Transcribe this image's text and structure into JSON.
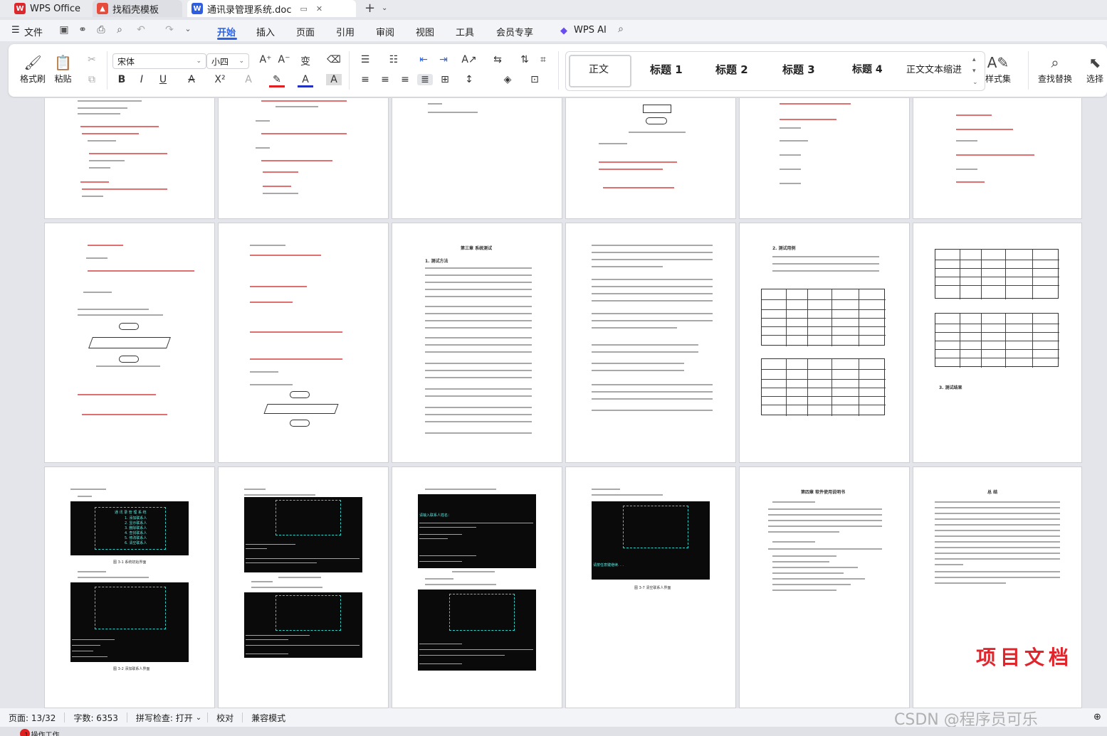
{
  "tabs": [
    {
      "label": "WPS Office",
      "logo": "W"
    },
    {
      "label": "找稻壳模板",
      "logo": "▲"
    },
    {
      "label": "通讯录管理系统.doc",
      "logo": "W"
    }
  ],
  "menu": {
    "file": "文件",
    "items": [
      "开始",
      "插入",
      "页面",
      "引用",
      "审阅",
      "视图",
      "工具",
      "会员专享"
    ],
    "active": "开始",
    "ai": "WPS AI"
  },
  "ribbon": {
    "format_painter": "格式刷",
    "paste": "粘贴",
    "font_name": "宋体",
    "font_size": "小四",
    "styles": [
      "正文",
      "标题 1",
      "标题 2",
      "标题 3",
      "标题 4",
      "正文文本缩进"
    ],
    "style_set": "样式集",
    "find_replace": "查找替换",
    "select": "选择"
  },
  "document": {
    "watermark": "项目文档",
    "chapter3_title": "第三章  系统测试",
    "chapter4_title": "第四章  软件使用说明书",
    "summary_title": "总  结",
    "test_section": "2. 测试用例",
    "result_section": "3. 测试结果",
    "test_method": "1. 测试方法",
    "menu_title": "通 讯 录 管 理 系 统",
    "menu_items": [
      "1. 添加联系人",
      "2. 显示联系人",
      "3. 删除联系人",
      "4. 查找联系人",
      "5. 修改联系人",
      "6. 清空联系人",
      "0. 退出通讯录"
    ],
    "captions": [
      "图 3-1 系统初始界面",
      "图 3-2 添加联系人界面",
      "图 3-3 显示联系人界面",
      "图 3-4 删除联系人界面",
      "图 3-5 查找联系人界面",
      "图 3-6 修改联系人界面",
      "图 3-7 清空联系人界面"
    ],
    "console_text": [
      "请输入联系人姓名：",
      "请输入性别：",
      "1 --- 男",
      "2 --- 女",
      "请输入年龄：",
      "请输入联系电话：",
      "请输入家庭住址：",
      "添加成功",
      "请按任意键继续. . ."
    ]
  },
  "status": {
    "page": "页面: 13/32",
    "words": "字数: 6353",
    "spell": "拼写检查: 打开",
    "proof": "校对",
    "compat": "兼容模式"
  },
  "taskbar": {
    "label": "1 操作工作"
  },
  "csdn_watermark": "CSDN @程序员可乐"
}
